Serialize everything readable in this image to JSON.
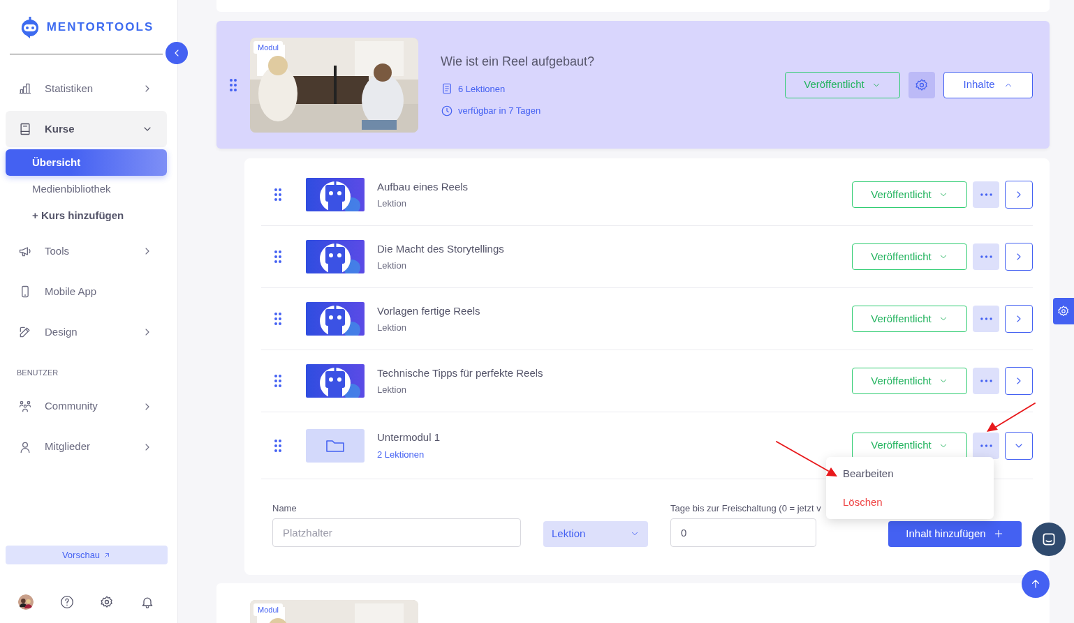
{
  "brand": {
    "name": "MENTORTOOLS"
  },
  "sidebar": {
    "items": [
      {
        "kind": "group",
        "label": "Statistiken",
        "expanded": false
      },
      {
        "kind": "group",
        "label": "Kurse",
        "expanded": true,
        "children": [
          {
            "label": "Übersicht",
            "selected": true
          },
          {
            "label": "Medienbibliothek",
            "selected": false
          },
          {
            "label": "+ Kurs hinzufügen",
            "selected": false
          }
        ]
      },
      {
        "kind": "group",
        "label": "Tools",
        "expanded": false
      },
      {
        "kind": "link",
        "label": "Mobile App"
      },
      {
        "kind": "group",
        "label": "Design",
        "expanded": false
      },
      {
        "kind": "heading",
        "label": "BENUTZER"
      },
      {
        "kind": "group",
        "label": "Community",
        "expanded": false
      },
      {
        "kind": "group",
        "label": "Mitglieder",
        "expanded": false
      }
    ],
    "preview_button": "Vorschau"
  },
  "module": {
    "badge": "Modul",
    "title": "Wie ist ein Reel aufgebaut?",
    "lessons": "6 Lektionen",
    "availability": "verfügbar in 7 Tagen",
    "status": "Veröffentlicht",
    "contents_button": "Inhalte",
    "expanded": true
  },
  "items": [
    {
      "kind": "lesson",
      "title": "Aufbau eines Reels",
      "subtitle": "Lektion",
      "status": "Veröffentlicht"
    },
    {
      "kind": "lesson",
      "title": "Die Macht des Storytellings",
      "subtitle": "Lektion",
      "status": "Veröffentlicht"
    },
    {
      "kind": "lesson",
      "title": "Vorlagen fertige Reels",
      "subtitle": "Lektion",
      "status": "Veröffentlicht"
    },
    {
      "kind": "lesson",
      "title": "Technische Tipps für perfekte Reels",
      "subtitle": "Lektion",
      "status": "Veröffentlicht"
    },
    {
      "kind": "submodule",
      "title": "Untermodul 1",
      "subtitle": "2 Lektionen",
      "status": "Veröffentlicht",
      "expanded": false,
      "menu": [
        {
          "label": "Bearbeiten",
          "kind": "normal"
        },
        {
          "label": "Löschen",
          "kind": "danger"
        }
      ]
    }
  ],
  "form": {
    "name_label": "Name",
    "name_placeholder": "Platzhalter",
    "type_select": "Lektion",
    "days_label": "Tage bis zur Freischaltung (0 = jetzt v",
    "days_value": "0",
    "add_button": "Inhalt hinzufügen"
  },
  "next_module": {
    "badge": "Modul"
  }
}
